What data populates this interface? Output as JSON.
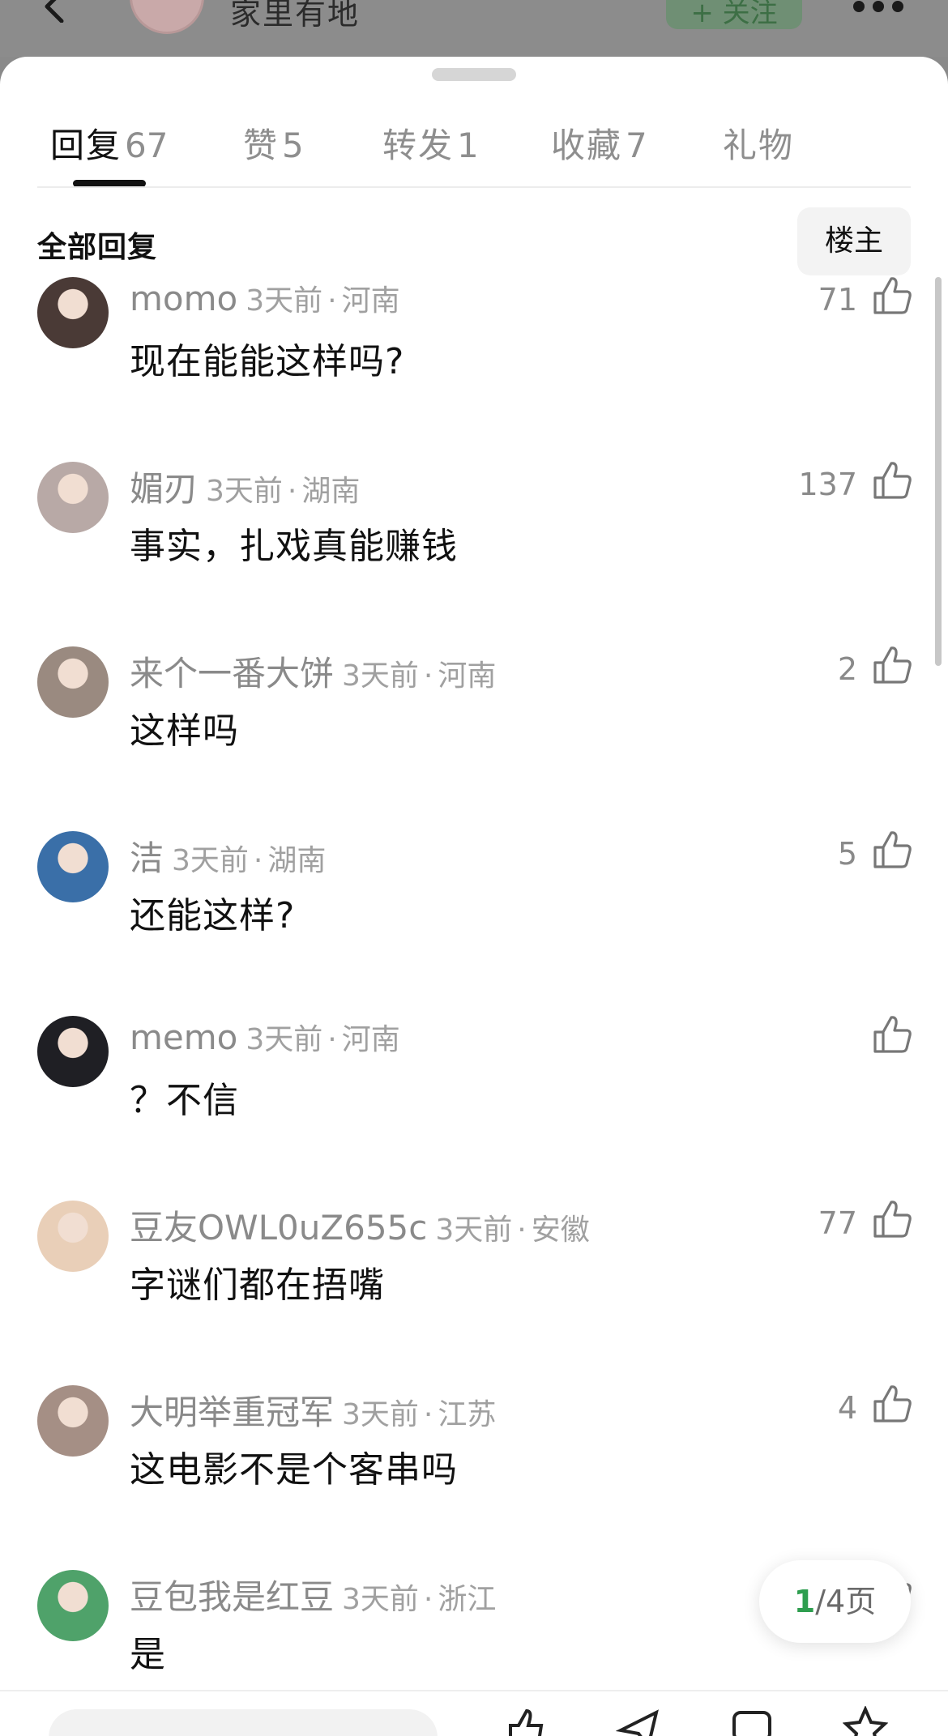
{
  "header": {
    "username": "家里有地",
    "follow_label": "+ 关注"
  },
  "tabs": [
    {
      "label": "回复",
      "count": "67"
    },
    {
      "label": "赞",
      "count": "5"
    },
    {
      "label": "转发",
      "count": "1"
    },
    {
      "label": "收藏",
      "count": "7"
    },
    {
      "label": "礼物",
      "count": ""
    }
  ],
  "section": {
    "title": "全部回复",
    "op_button": "楼主"
  },
  "comments": [
    {
      "name": "momo",
      "time": "3天前",
      "location": "河南",
      "text": "现在能能这样吗?",
      "likes": "71",
      "avatar_color": "#4a3a36"
    },
    {
      "name": "媚刃",
      "time": "3天前",
      "location": "湖南",
      "text": "事实，扎戏真能赚钱",
      "likes": "137",
      "avatar_color": "#b8a9a6"
    },
    {
      "name": "来个一番大饼",
      "time": "3天前",
      "location": "河南",
      "text": "这样吗",
      "likes": "2",
      "avatar_color": "#9a8a80"
    },
    {
      "name": "洁",
      "time": "3天前",
      "location": "湖南",
      "text": "还能这样?",
      "likes": "5",
      "avatar_color": "#3a6fa8"
    },
    {
      "name": "memo",
      "time": "3天前",
      "location": "河南",
      "text": "？不信",
      "likes": "",
      "avatar_color": "#1f1f24"
    },
    {
      "name": "豆友OWL0uZ655c",
      "time": "3天前",
      "location": "安徽",
      "text": "字谜们都在捂嘴",
      "likes": "77",
      "avatar_color": "#e9cfb8"
    },
    {
      "name": "大明举重冠军",
      "time": "3天前",
      "location": "江苏",
      "text": "这电影不是个客串吗",
      "likes": "4",
      "avatar_color": "#a58f85"
    },
    {
      "name": "豆包我是红豆",
      "time": "3天前",
      "location": "浙江",
      "text": "是",
      "likes": "",
      "avatar_color": "#4fa26a"
    }
  ],
  "pager": {
    "current": "1",
    "total_label": "/4页"
  },
  "colors": {
    "accent_green": "#2e9e4f",
    "meta_gray": "#a0a0a0"
  }
}
